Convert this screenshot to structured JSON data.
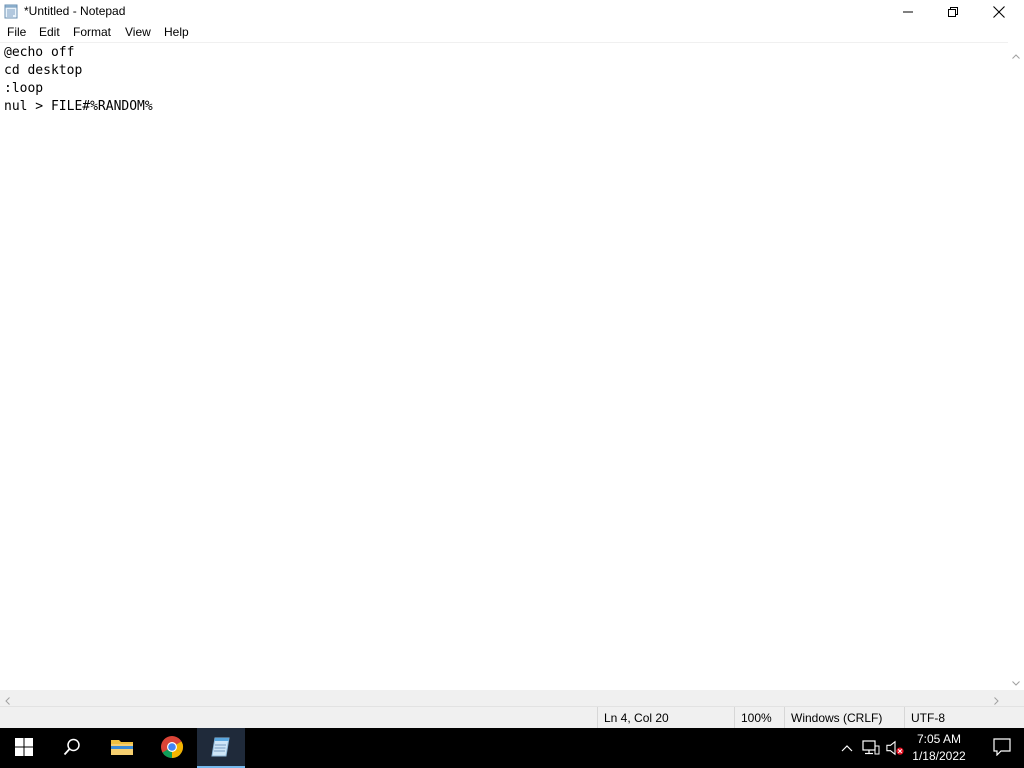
{
  "window": {
    "title": "*Untitled - Notepad",
    "icon": "notepad-icon",
    "controls": [
      "minimize-icon",
      "restore-icon",
      "close-icon"
    ]
  },
  "menu": {
    "items": [
      "File",
      "Edit",
      "Format",
      "View",
      "Help"
    ]
  },
  "editor": {
    "lines": [
      "@echo off",
      "cd desktop",
      ":loop",
      "nul > FILE#%RANDOM%"
    ]
  },
  "statusbar": {
    "position": "Ln 4, Col 20",
    "zoom": "100%",
    "line_ending": "Windows (CRLF)",
    "encoding": "UTF-8"
  },
  "taskbar": {
    "apps": [
      "start-icon",
      "search-icon",
      "file-explorer-icon",
      "chrome-icon",
      "notepad-icon"
    ],
    "active_app": "Notepad",
    "tray_icons": [
      "chevron-up-icon",
      "network-icon",
      "volume-muted-icon"
    ],
    "time": "7:05 AM",
    "date": "1/18/2022"
  },
  "colors": {
    "taskbar_bg": "#000000",
    "active_indicator": "#76b9ed",
    "statusbar_bg": "#f0f0f0"
  }
}
